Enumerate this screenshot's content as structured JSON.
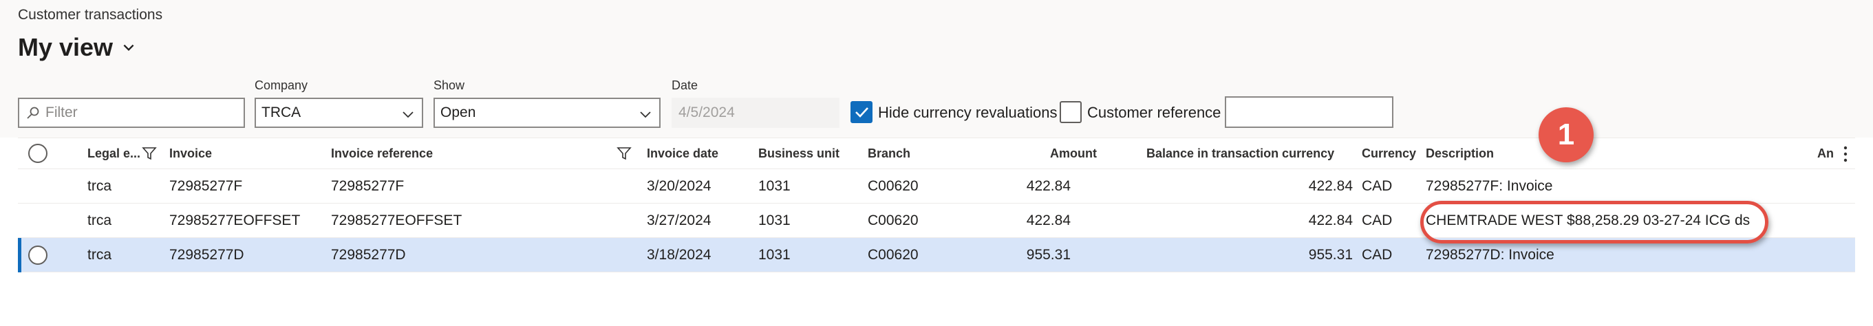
{
  "page": {
    "breadcrumb": "Customer transactions",
    "view_title": "My view"
  },
  "filters": {
    "filter_placeholder": "Filter",
    "company_label": "Company",
    "company_value": "TRCA",
    "show_label": "Show",
    "show_value": "Open",
    "date_label": "Date",
    "date_value": "4/5/2024",
    "hide_currency_label": "Hide currency revaluations",
    "hide_currency_checked": true,
    "customer_ref_label": "Customer reference",
    "customer_ref_checked": false,
    "customer_ref_value": ""
  },
  "grid": {
    "columns": {
      "legal_entity": "Legal e...",
      "invoice": "Invoice",
      "invoice_reference": "Invoice reference",
      "invoice_date": "Invoice date",
      "business_unit": "Business unit",
      "branch": "Branch",
      "amount": "Amount",
      "balance": "Balance in transaction currency",
      "currency": "Currency",
      "description": "Description",
      "truncated": "An"
    },
    "rows": [
      {
        "legal_entity": "trca",
        "invoice": "72985277F",
        "invoice_reference": "72985277F",
        "invoice_date": "3/20/2024",
        "business_unit": "1031",
        "branch": "C00620",
        "amount": "422.84",
        "balance": "422.84",
        "currency": "CAD",
        "description": "72985277F: Invoice",
        "selected": false
      },
      {
        "legal_entity": "trca",
        "invoice": "72985277EOFFSET",
        "invoice_reference": "72985277EOFFSET",
        "invoice_date": "3/27/2024",
        "business_unit": "1031",
        "branch": "C00620",
        "amount": "422.84",
        "balance": "422.84",
        "currency": "CAD",
        "description": "CHEMTRADE WEST $88,258.29 03-27-24 ICG ds",
        "selected": false
      },
      {
        "legal_entity": "trca",
        "invoice": "72985277D",
        "invoice_reference": "72985277D",
        "invoice_date": "3/18/2024",
        "business_unit": "1031",
        "branch": "C00620",
        "amount": "955.31",
        "balance": "955.31",
        "currency": "CAD",
        "description": "72985277D: Invoice",
        "selected": true
      }
    ]
  },
  "annotation": {
    "badge_number": "1",
    "color": "#e34f44"
  },
  "colors": {
    "accent": "#0f6cbd",
    "selected_row": "#d8e5f9",
    "page_bg": "#faf9f8"
  },
  "icons": [
    "search-icon",
    "chevron-down-icon",
    "filter-funnel-icon",
    "checkmark-icon",
    "more-vertical-icon"
  ]
}
